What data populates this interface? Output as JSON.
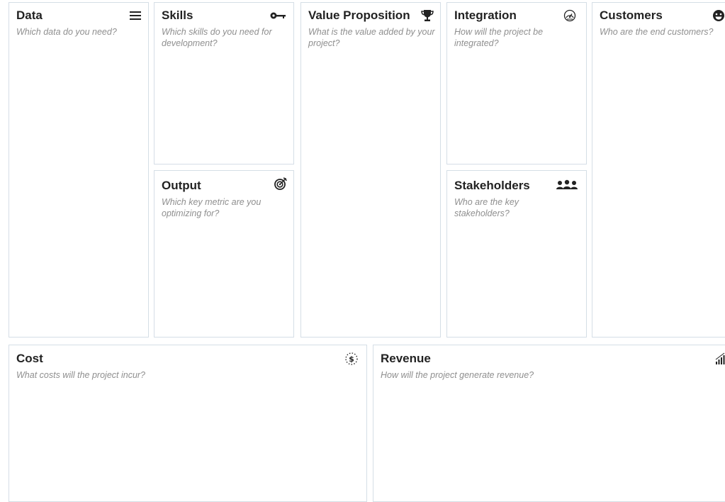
{
  "canvas": {
    "data": {
      "title": "Data",
      "question": "Which data do you need?",
      "icon": "menu-lines-icon"
    },
    "skills": {
      "title": "Skills",
      "question": "Which skills do you need for development?",
      "icon": "key-icon"
    },
    "value_proposition": {
      "title": "Value Proposition",
      "question": "What is the value added by your project?",
      "icon": "trophy-icon"
    },
    "integration": {
      "title": "Integration",
      "question": "How will the project be integrated?",
      "icon": "integration-gauge-icon"
    },
    "customers": {
      "title": "Customers",
      "question": "Who are the end customers?",
      "icon": "smiley-icon"
    },
    "output": {
      "title": "Output",
      "question": "Which key metric are you optimizing for?",
      "icon": "target-icon"
    },
    "stakeholders": {
      "title": "Stakeholders",
      "question": "Who are the key stakeholders?",
      "icon": "group-icon"
    },
    "cost": {
      "title": "Cost",
      "question": "What costs will the project incur?",
      "icon": "dollar-icon"
    },
    "revenue": {
      "title": "Revenue",
      "question": "How will the project generate revenue?",
      "icon": "growth-bars-icon"
    }
  },
  "colors": {
    "border": "#d5dee6",
    "title": "#222222",
    "hint": "#8f8f8f"
  }
}
